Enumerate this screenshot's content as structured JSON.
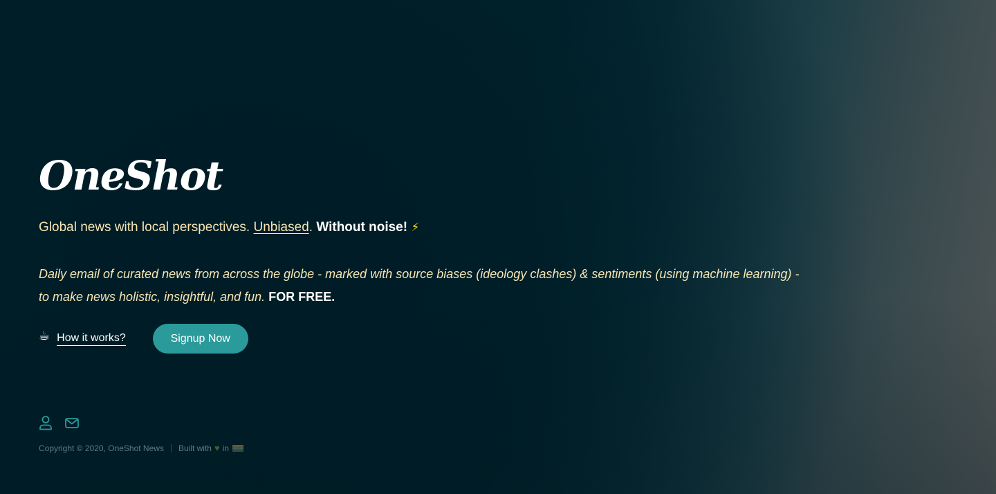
{
  "brand": {
    "logo": "OneShot"
  },
  "hero": {
    "tagline_lead": "Global news with local perspectives. ",
    "tagline_link": "Unbiased",
    "tagline_period": ". ",
    "tagline_strong": "Without noise!",
    "tagline_emoji": "⚡",
    "description": "Daily email of curated news from across the globe - marked with source biases (ideology clashes) & sentiments (using machine learning) - to make news holistic, insightful, and fun.",
    "description_strong": "FOR FREE."
  },
  "actions": {
    "how_icon": "☕",
    "how_label": "How it works?",
    "signup_label": "Signup Now"
  },
  "social": {
    "icons": [
      "user-icon",
      "mail-icon"
    ]
  },
  "footer": {
    "copyright": "Copyright © 2020, OneShot News",
    "built_with": "Built with",
    "heart": "♥",
    "in": "in",
    "flag_icon": "india-flag-icon"
  },
  "colors": {
    "accent": "#2b9a9b",
    "tagline": "#f6e5b3",
    "background": "#00202a"
  }
}
